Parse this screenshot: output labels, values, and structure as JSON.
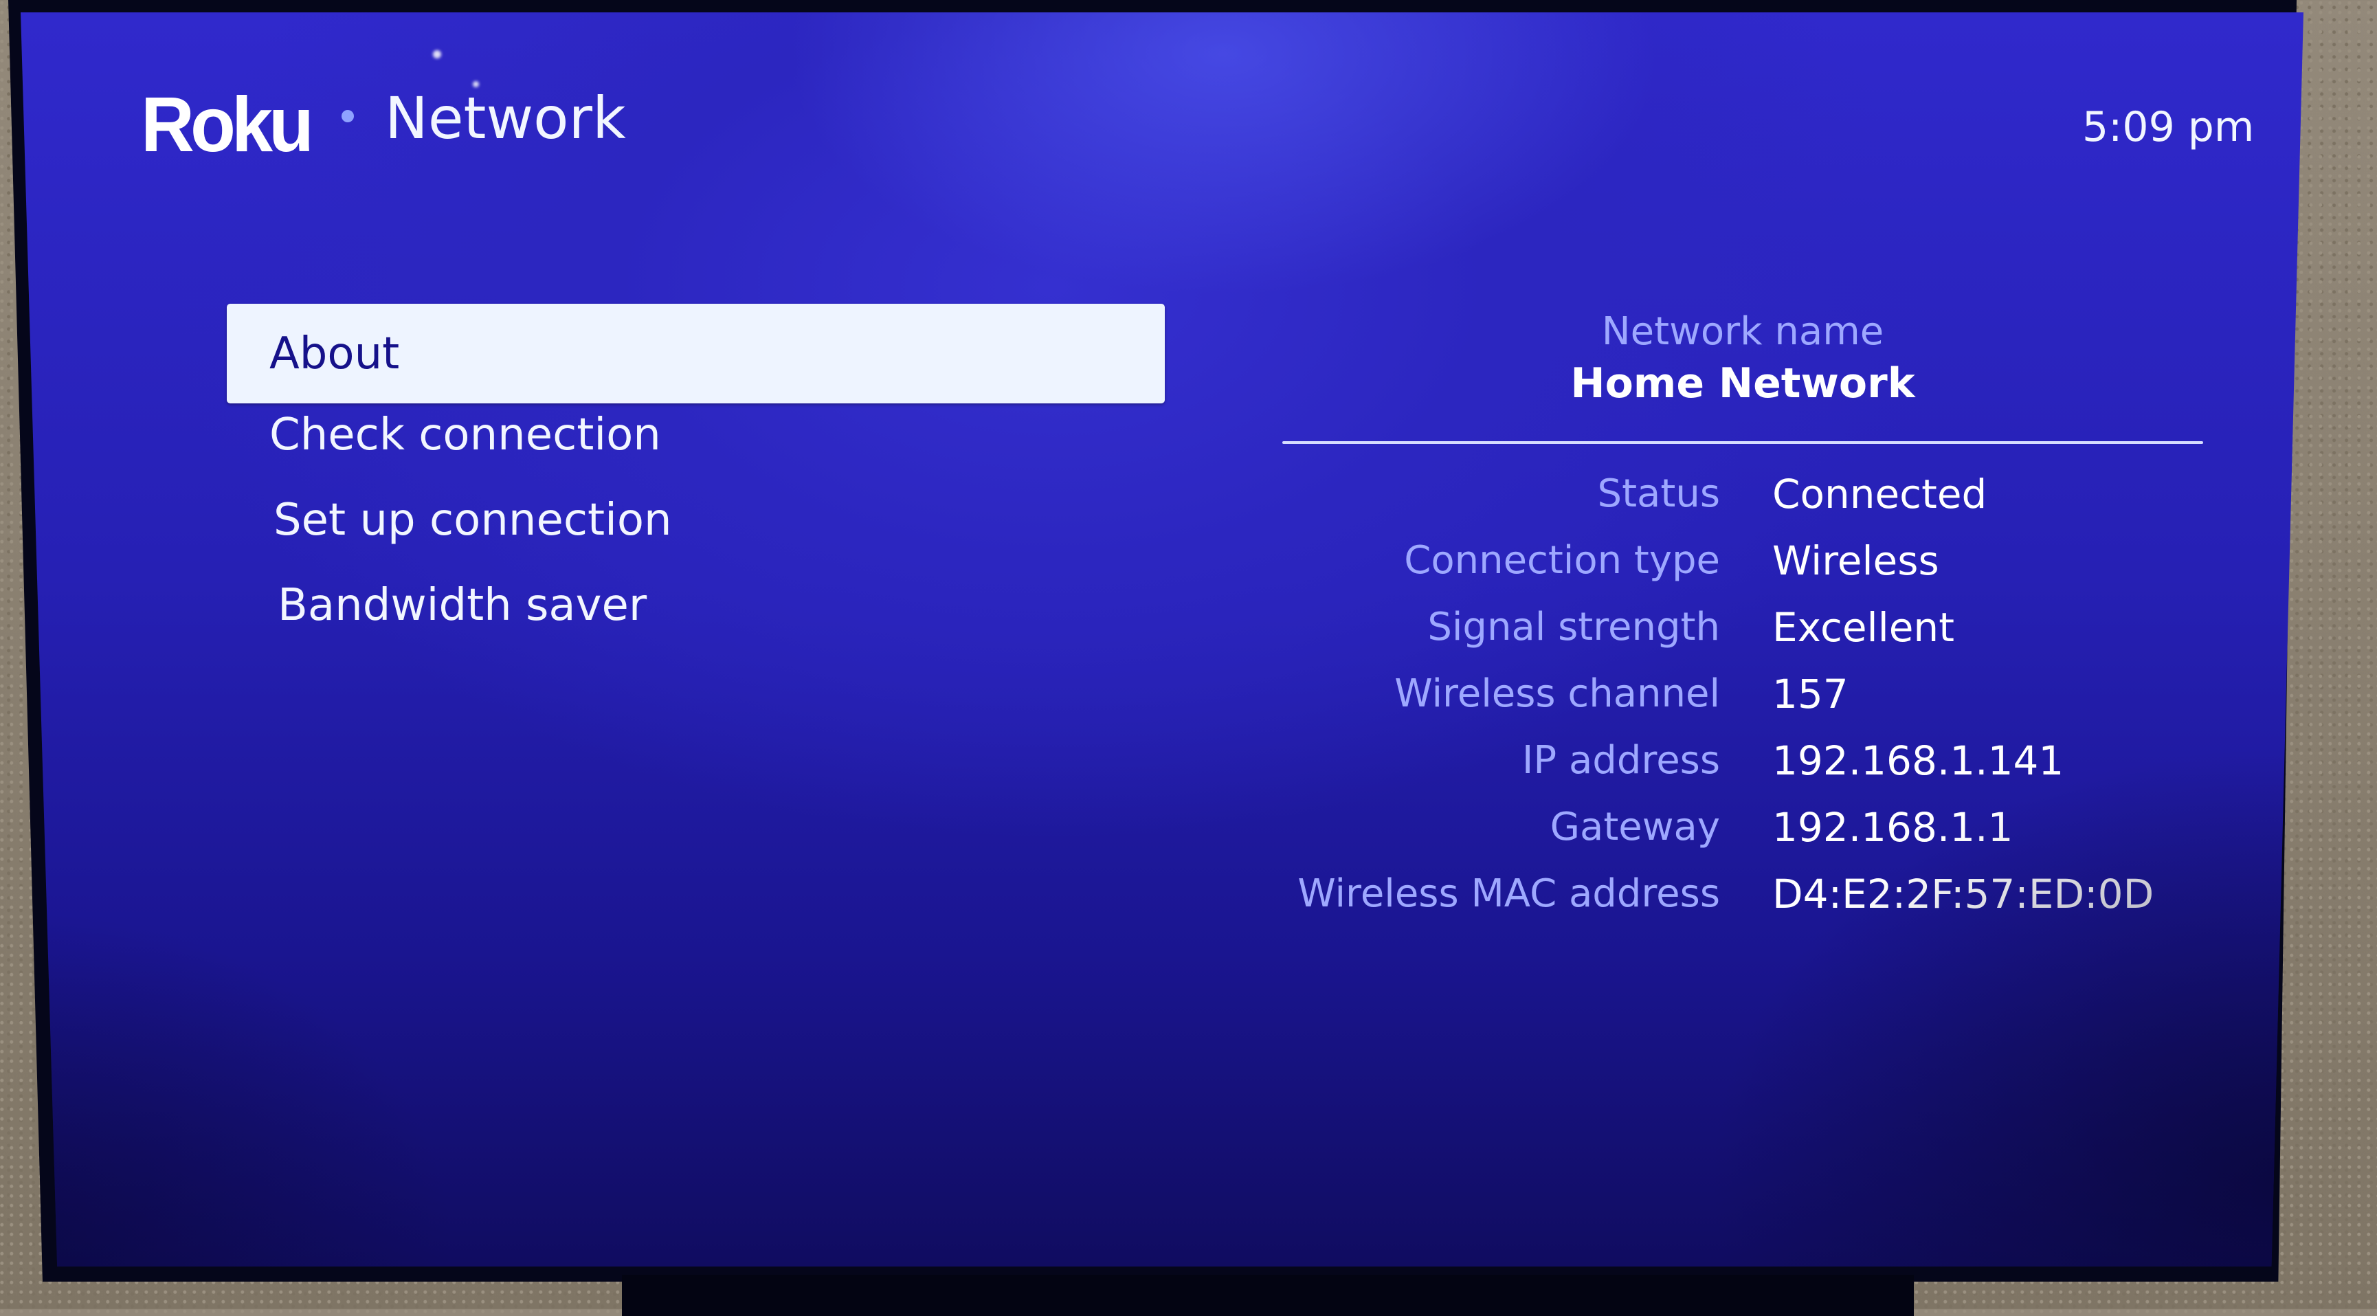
{
  "header": {
    "brand": "Roku",
    "separator": "•",
    "title": "Network",
    "time": "5:09 pm"
  },
  "menu": {
    "items": [
      {
        "label": "About",
        "selected": true
      },
      {
        "label": "Check connection",
        "selected": false
      },
      {
        "label": "Set up connection",
        "selected": false
      },
      {
        "label": "Bandwidth saver",
        "selected": false
      }
    ]
  },
  "info": {
    "network_name_label": "Network name",
    "network_name": "Home Network",
    "rows": [
      {
        "label": "Status",
        "value": "Connected"
      },
      {
        "label": "Connection type",
        "value": "Wireless"
      },
      {
        "label": "Signal strength",
        "value": "Excellent"
      },
      {
        "label": "Wireless channel",
        "value": "157"
      },
      {
        "label": "IP address",
        "value": "192.168.1.141"
      },
      {
        "label": "Gateway",
        "value": "192.168.1.1"
      },
      {
        "label": "Wireless MAC address",
        "value": "D4:E2:2F:57:ED:0D"
      }
    ]
  },
  "colors": {
    "background": "#2c26c0",
    "selected_bg": "#eef4ff",
    "selected_text": "#16118a",
    "label_text": "#9ea8ff",
    "value_text": "#ffffff"
  }
}
